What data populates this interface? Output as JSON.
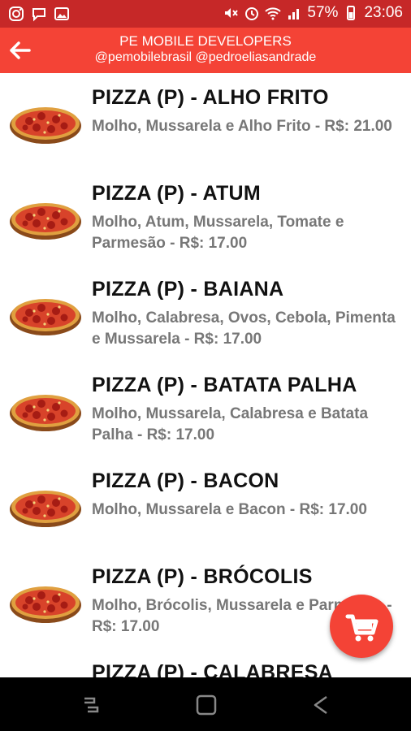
{
  "status": {
    "battery": "57%",
    "time": "23:06"
  },
  "appbar": {
    "title": "PE MOBILE DEVELOPERS",
    "subtitle": "@pemobilebrasil @pedroeliasandrade"
  },
  "items": [
    {
      "name": "PIZZA (P) - ALHO FRITO",
      "desc": "Molho, Mussarela e Alho Frito - R$: 21.00"
    },
    {
      "name": "PIZZA (P) - ATUM",
      "desc": "Molho, Atum, Mussarela, Tomate e Parmesão - R$: 17.00"
    },
    {
      "name": "PIZZA (P) - BAIANA",
      "desc": "Molho, Calabresa, Ovos, Cebola, Pimenta e Mussarela - R$: 17.00"
    },
    {
      "name": "PIZZA (P) - BATATA PALHA",
      "desc": "Molho, Mussarela, Calabresa e Batata Palha - R$: 17.00"
    },
    {
      "name": "PIZZA (P) - BACON",
      "desc": "Molho, Mussarela e Bacon - R$: 17.00"
    },
    {
      "name": "PIZZA (P) - BRÓCOLIS",
      "desc": "Molho, Brócolis, Mussarela e Parmesão - R$: 17.00"
    },
    {
      "name": "PIZZA (P) - CALABRESA",
      "desc": ""
    }
  ],
  "icons": {
    "back": "arrow-back-icon",
    "fab": "shopping-cart-icon",
    "nav": [
      "recents-icon",
      "home-icon",
      "back-nav-icon"
    ]
  },
  "colors": {
    "statusbar": "#c62828",
    "appbar": "#f44336",
    "fab": "#f44336"
  }
}
